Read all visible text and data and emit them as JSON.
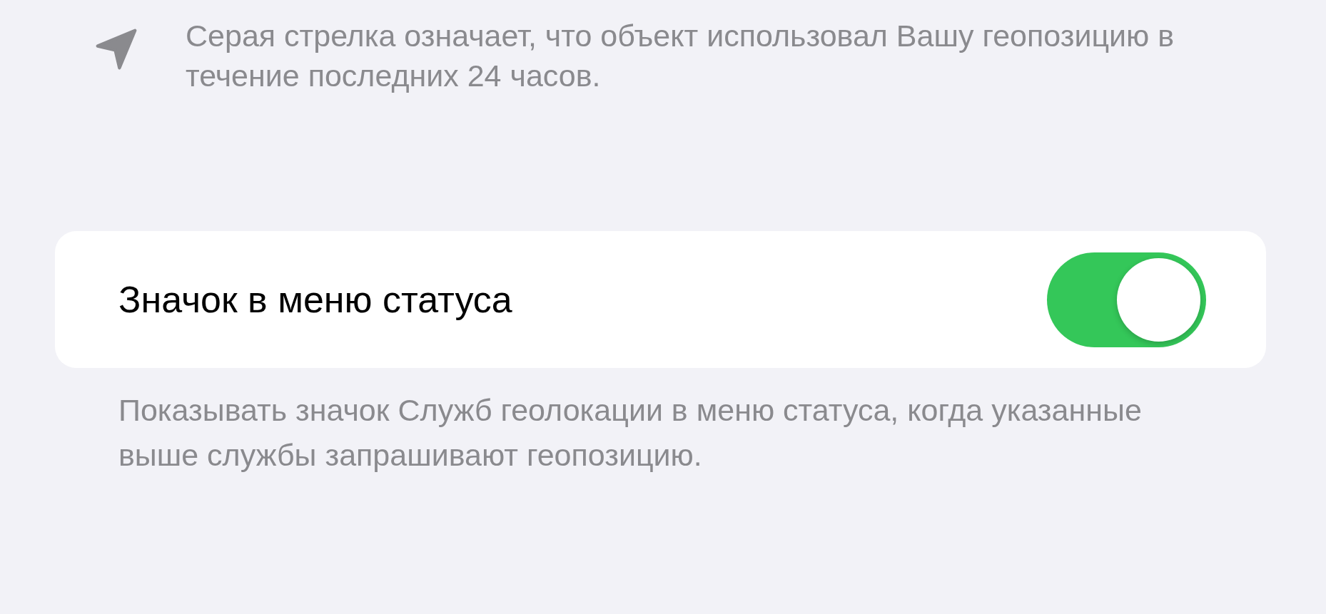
{
  "location_note": {
    "text": "Серая стрелка означает, что объект использовал Вашу геопозицию в течение последних 24 часов."
  },
  "status_icon_setting": {
    "label": "Значок в меню статуса",
    "on": true
  },
  "footer": {
    "text": "Показывать значок Служб геолокации в меню статуса, когда указанные выше службы запрашивают геопозицию."
  }
}
